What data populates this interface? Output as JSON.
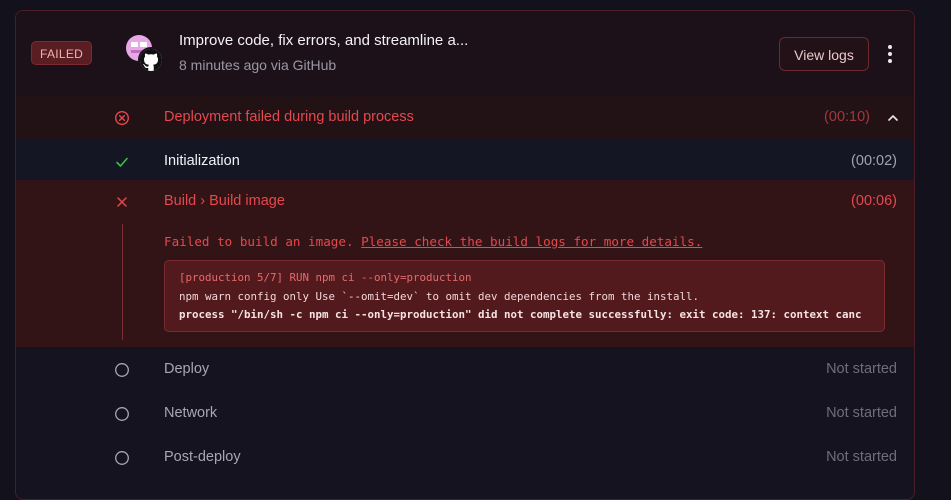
{
  "deployment": {
    "status_badge": "FAILED",
    "commit_title": "Improve code, fix errors, and streamline a...",
    "meta": "8 minutes ago via GitHub",
    "view_logs_label": "View logs"
  },
  "summary": {
    "label": "Deployment failed during build process",
    "time": "(00:10)"
  },
  "steps": [
    {
      "label": "Initialization",
      "time": "(00:02)",
      "status": "success"
    },
    {
      "label": "Build › Build image",
      "time": "(00:06)",
      "status": "failed"
    },
    {
      "label": "Deploy",
      "time": "Not started",
      "status": "pending"
    },
    {
      "label": "Network",
      "time": "Not started",
      "status": "pending"
    },
    {
      "label": "Post-deploy",
      "time": "Not started",
      "status": "pending"
    }
  ],
  "build_error": {
    "message": "Failed to build an image. ",
    "link_text": "Please check the build logs for more details.",
    "log_lines": [
      "[production 5/7] RUN npm ci --only=production",
      "npm warn config only Use `--omit=dev` to omit dev dependencies from the install.",
      "process \"/bin/sh -c npm ci --only=production\" did not complete successfully: exit code: 137: context canc"
    ]
  },
  "colors": {
    "error": "#e5484d",
    "success": "#3fb950",
    "pending": "#8b8a96",
    "background": "#13111c"
  },
  "icons": {
    "summary": "error-circle-icon",
    "initialization": "check-icon",
    "build": "x-icon",
    "pending": "empty-circle-icon",
    "collapse": "chevron-up-icon",
    "more": "kebab-menu-icon"
  }
}
